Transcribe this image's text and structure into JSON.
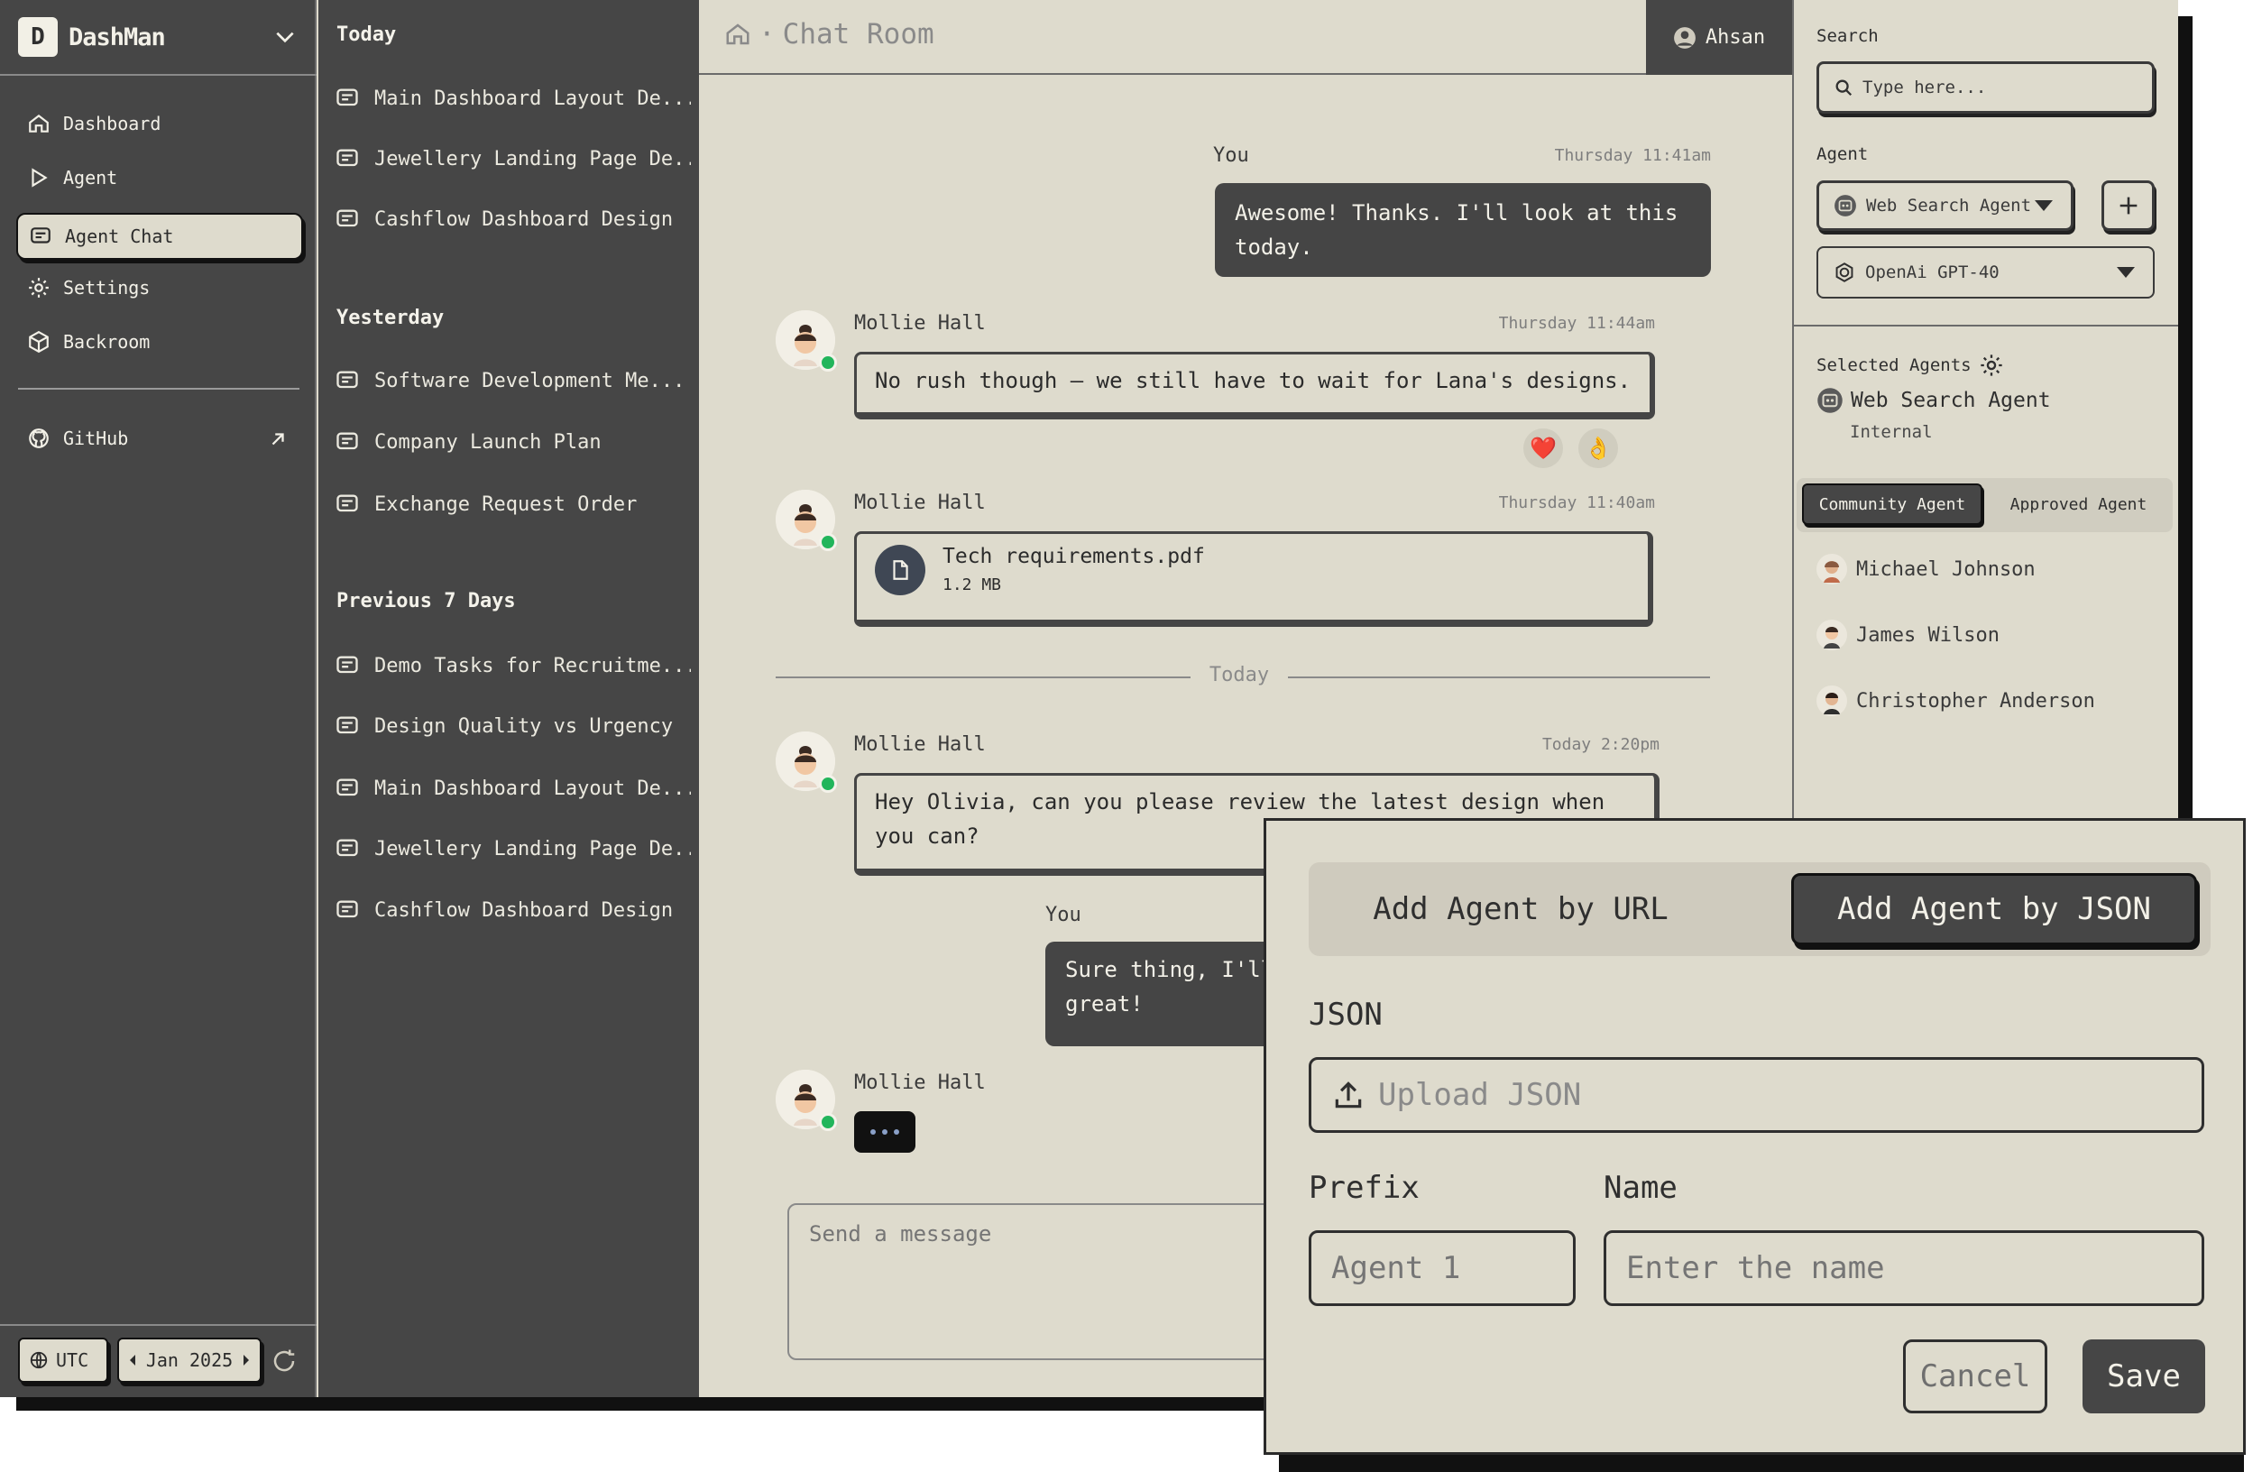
{
  "brand": {
    "logo_letter": "D",
    "name": "DashMan"
  },
  "nav": {
    "items": [
      {
        "label": "Dashboard",
        "icon": "home-icon"
      },
      {
        "label": "Agent",
        "icon": "play-icon"
      },
      {
        "label": "Agent Chat",
        "icon": "chat-icon",
        "active": true
      },
      {
        "label": "Settings",
        "icon": "gear-icon"
      },
      {
        "label": "Backroom",
        "icon": "box-icon"
      }
    ],
    "github": "GitHub",
    "timezone": "UTC",
    "month": "Jan 2025"
  },
  "history": {
    "today": {
      "heading": "Today",
      "items": [
        "Main Dashboard Layout De...",
        "Jewellery Landing Page De...",
        "Cashflow Dashboard Design"
      ]
    },
    "yesterday": {
      "heading": "Yesterday",
      "items": [
        "Software Development Me...",
        "Company Launch Plan",
        "Exchange Request Order"
      ]
    },
    "previous": {
      "heading": "Previous 7 Days",
      "items": [
        "Demo Tasks for Recruitme...",
        "Design Quality vs Urgency",
        "Main Dashboard Layout De...",
        "Jewellery Landing Page De...",
        "Cashflow Dashboard Design"
      ]
    }
  },
  "chat": {
    "breadcrumb": {
      "separator": "·",
      "title": "Chat Room"
    },
    "user": "Ahsan",
    "messages": [
      {
        "sender": "You",
        "time": "Thursday 11:41am",
        "text": "Awesome! Thanks. I'll look at this today."
      },
      {
        "sender": "Mollie Hall",
        "time": "Thursday 11:44am",
        "text": "No rush though — we still have to wait for Lana's designs.",
        "reactions": [
          "❤️",
          "👌"
        ]
      },
      {
        "sender": "Mollie Hall",
        "time": "Thursday 11:40am",
        "file_name": "Tech requirements.pdf",
        "file_size": "1.2 MB"
      },
      {
        "sender": "Mollie Hall",
        "time": "Today 2:20pm",
        "text": "Hey Olivia, can you please review the latest design when you can?"
      },
      {
        "sender": "You",
        "text_line1": "Sure thing, I'll hav",
        "text_line2": "great!"
      },
      {
        "sender": "Mollie Hall"
      }
    ],
    "divider": "Today",
    "composer_placeholder": "Send a message"
  },
  "right": {
    "search_label": "Search",
    "search_placeholder": "Type here...",
    "agent_label": "Agent",
    "agent_select": "Web Search Agent",
    "model_select": "OpenAi GPT-40",
    "selected_label": "Selected Agents",
    "selected_agent": {
      "name": "Web Search Agent",
      "type": "Internal"
    },
    "tabs": [
      "Community Agent",
      "Approved Agent"
    ],
    "people": [
      "Michael Johnson",
      "James Wilson",
      "Christopher Anderson"
    ]
  },
  "modal": {
    "tab_url": "Add Agent by URL",
    "tab_json": "Add Agent by JSON",
    "json_label": "JSON",
    "upload_placeholder": "Upload JSON",
    "prefix_label": "Prefix",
    "prefix_placeholder": "Agent 1",
    "name_label": "Name",
    "name_placeholder": "Enter the name",
    "cancel": "Cancel",
    "save": "Save"
  },
  "colors": {
    "sidebar_bg": "#464646",
    "surface": "#dedbcd",
    "online_dot": "#22b55b",
    "dark_bubble": "#454545"
  }
}
